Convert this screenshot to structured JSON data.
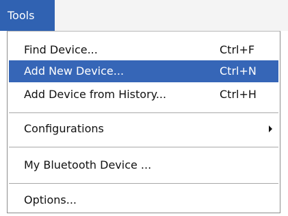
{
  "menubar": {
    "title": "Tools"
  },
  "menu": {
    "items": [
      {
        "label": "Find Device...",
        "shortcut": "Ctrl+F"
      },
      {
        "label": "Add New Device...",
        "shortcut": "Ctrl+N",
        "highlighted": true
      },
      {
        "label": "Add Device from History...",
        "shortcut": "Ctrl+H"
      },
      {
        "label": "Configurations",
        "submenu_icon": "chevron-right-icon"
      },
      {
        "label": "My Bluetooth Device ..."
      },
      {
        "label": "Options..."
      }
    ]
  },
  "colors": {
    "highlight": "#3666b7",
    "menu_title_bg": "#3062b2"
  }
}
